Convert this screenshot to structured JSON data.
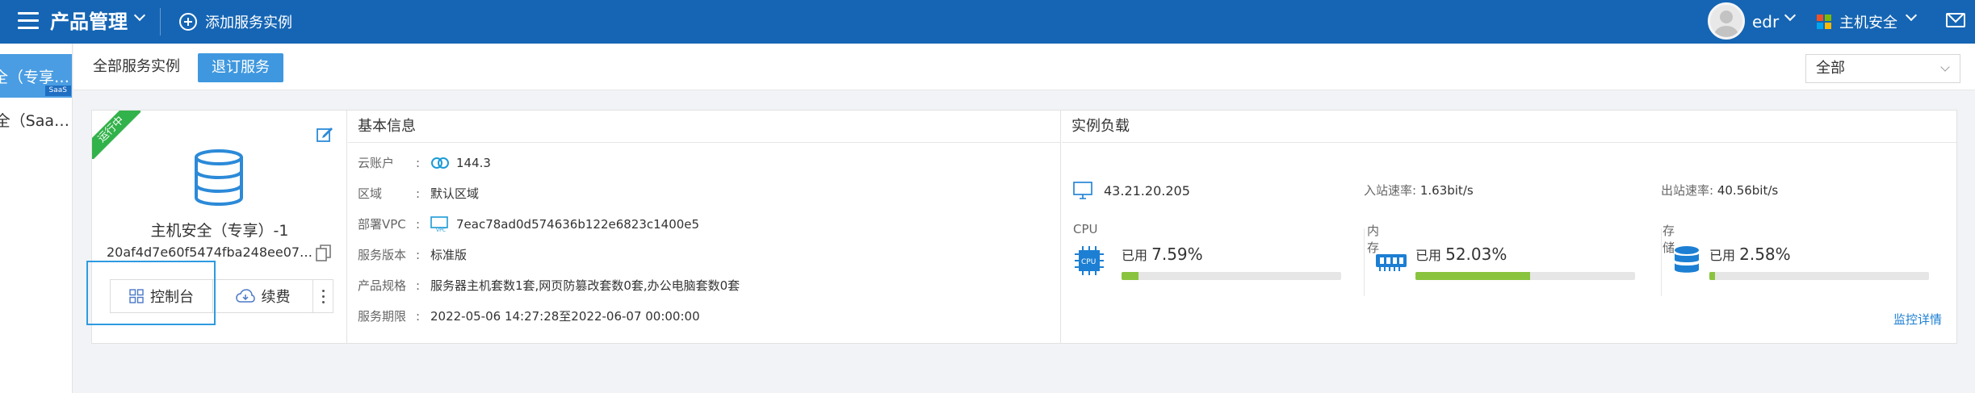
{
  "topbar": {
    "app_title": "产品管理",
    "add_instance_label": "添加服务实例",
    "username": "edr",
    "product_switch_label": "主机安全"
  },
  "sidebar": {
    "items": [
      {
        "label": "全（专享…",
        "active": true,
        "badge": "SaaS"
      },
      {
        "label": "全（Saa…",
        "active": false
      }
    ]
  },
  "subbar": {
    "tab_all_label": "全部服务实例",
    "unsubscribe_label": "退订服务",
    "filter_value": "全部"
  },
  "instance": {
    "status_ribbon": "运行中",
    "name": "主机安全（专享）-1",
    "id": "20af4d7e60f5474fba248ee07004…",
    "console_label": "控制台",
    "renew_label": "续费",
    "basic_info": {
      "title": "基本信息",
      "rows": [
        {
          "key": "云账户",
          "value": "144.3"
        },
        {
          "key": "区域",
          "value": "默认区域"
        },
        {
          "key": "部署VPC",
          "value": "7eac78ad0d574636b122e6823c1400e5"
        },
        {
          "key": "服务版本",
          "value": "标准版"
        },
        {
          "key": "产品规格",
          "value": "服务器主机套数1套,网页防篡改套数0套,办公电脑套数0套"
        },
        {
          "key": "服务期限",
          "value": "2022-05-06 14:27:28至2022-06-07 00:00:00"
        }
      ]
    },
    "load": {
      "title": "实例负载",
      "ip": "43.21.20.205",
      "inbound_label": "入站速率:",
      "inbound_value": "1.63bit/s",
      "outbound_label": "出站速率:",
      "outbound_value": "40.56bit/s",
      "used_prefix": "已用",
      "metrics": [
        {
          "label": "CPU",
          "value": "7.59%",
          "percent": 7.59
        },
        {
          "label": "内存",
          "value": "52.03%",
          "percent": 52.03
        },
        {
          "label": "存储",
          "value": "2.58%",
          "percent": 2.58
        }
      ],
      "monitor_link": "监控详情"
    }
  },
  "colors": {
    "topbar": "#1565b4",
    "accent": "#3f98df",
    "running": "#32b24a",
    "bar_fill": "#8ac43f"
  }
}
